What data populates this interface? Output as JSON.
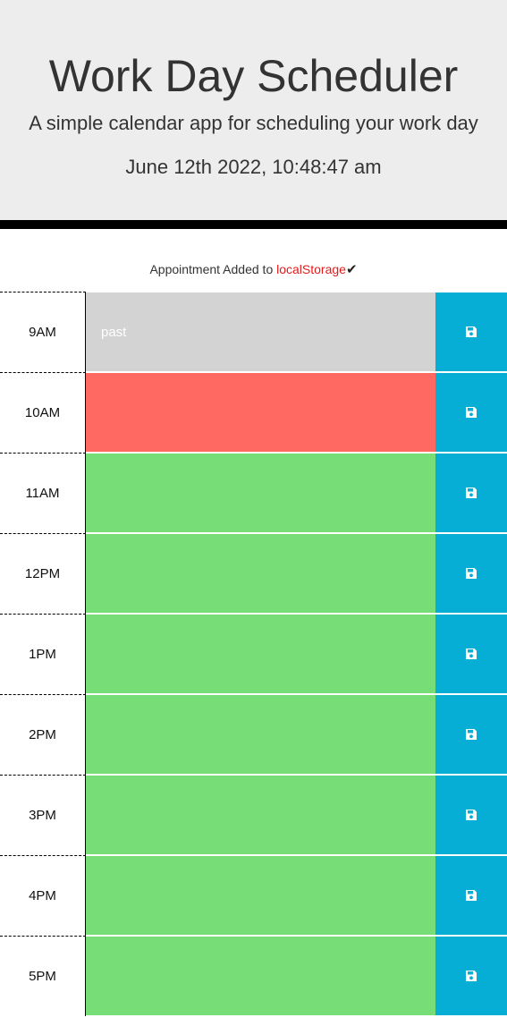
{
  "header": {
    "title": "Work Day Scheduler",
    "subtitle": "A simple calendar app for scheduling your work day",
    "current_date": "June 12th 2022, 10:48:47 am"
  },
  "notice": {
    "prefix": "Appointment Added to ",
    "storage": "localStorage",
    "check": "✔"
  },
  "timeblocks": [
    {
      "hour": "9AM",
      "status": "past",
      "text": "past"
    },
    {
      "hour": "10AM",
      "status": "present",
      "text": ""
    },
    {
      "hour": "11AM",
      "status": "future",
      "text": ""
    },
    {
      "hour": "12PM",
      "status": "future",
      "text": ""
    },
    {
      "hour": "1PM",
      "status": "future",
      "text": ""
    },
    {
      "hour": "2PM",
      "status": "future",
      "text": ""
    },
    {
      "hour": "3PM",
      "status": "future",
      "text": ""
    },
    {
      "hour": "4PM",
      "status": "future",
      "text": ""
    },
    {
      "hour": "5PM",
      "status": "future",
      "text": ""
    }
  ],
  "colors": {
    "past": "#d3d3d3",
    "present": "#ff6961",
    "future": "#77dd77",
    "save_button": "#06aed5",
    "storage_text": "#e31b1b"
  },
  "icons": {
    "save": "floppy-disk-icon"
  }
}
